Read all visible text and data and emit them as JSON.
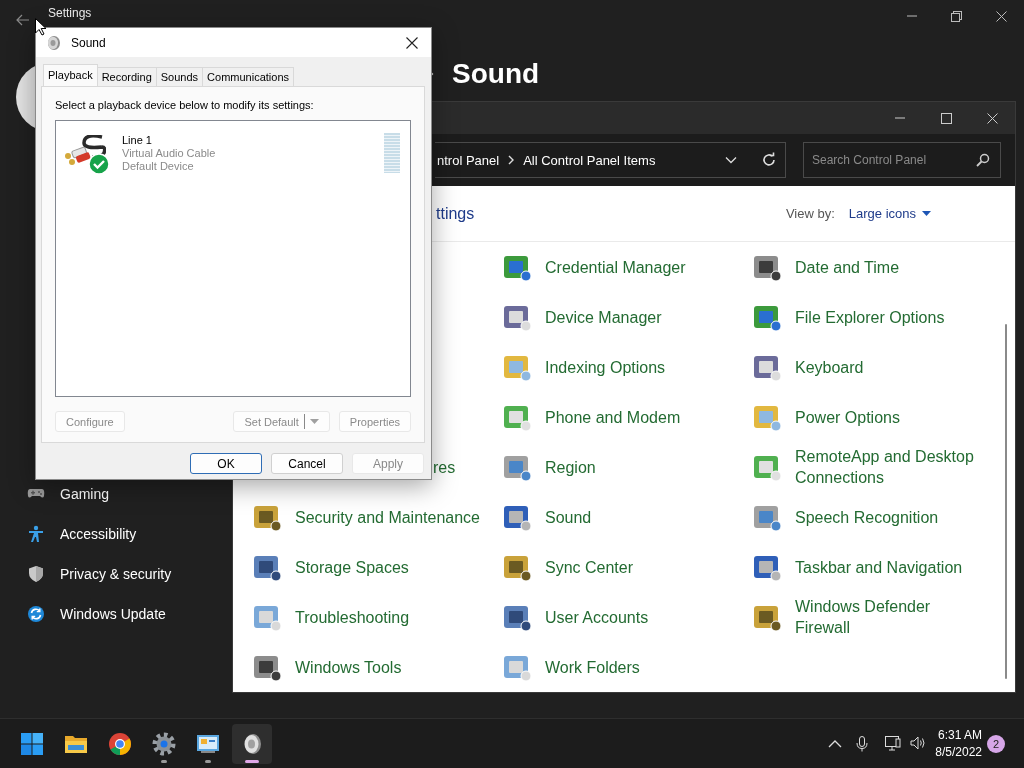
{
  "settings": {
    "title": "Settings",
    "header": "Sound",
    "nav": [
      {
        "label": "Gaming",
        "kind": "gaming"
      },
      {
        "label": "Accessibility",
        "kind": "accessibility"
      },
      {
        "label": "Privacy & security",
        "kind": "privacy"
      },
      {
        "label": "Windows Update",
        "kind": "update"
      }
    ]
  },
  "control_panel": {
    "address": [
      "ntrol Panel",
      "All Control Panel Items"
    ],
    "search": {
      "placeholder": "Search Control Panel"
    },
    "heading": "ttings",
    "view_by": {
      "label": "View by:",
      "value": "Large icons"
    },
    "columns": [
      {
        "items": [
          {
            "label": "res",
            "kind": "clipped"
          },
          {
            "label": "Security and Maintenance",
            "kind": "item"
          },
          {
            "label": "Storage Spaces",
            "kind": "item"
          },
          {
            "label": "Troubleshooting",
            "kind": "item"
          },
          {
            "label": "Windows Tools",
            "kind": "item"
          }
        ]
      },
      {
        "items": [
          {
            "label": "Credential Manager",
            "kind": "item"
          },
          {
            "label": "Device Manager",
            "kind": "item"
          },
          {
            "label": "Indexing Options",
            "kind": "item"
          },
          {
            "label": "Phone and Modem",
            "kind": "item"
          },
          {
            "label": "Region",
            "kind": "item"
          },
          {
            "label": "Sound",
            "kind": "item"
          },
          {
            "label": "Sync Center",
            "kind": "item"
          },
          {
            "label": "User Accounts",
            "kind": "item"
          },
          {
            "label": "Work Folders",
            "kind": "item"
          }
        ]
      },
      {
        "items": [
          {
            "label": "Date and Time",
            "kind": "item"
          },
          {
            "label": "File Explorer Options",
            "kind": "item"
          },
          {
            "label": "Keyboard",
            "kind": "item"
          },
          {
            "label": "Power Options",
            "kind": "item"
          },
          {
            "label": "RemoteApp and Desktop Connections",
            "kind": "item"
          },
          {
            "label": "Speech Recognition",
            "kind": "item"
          },
          {
            "label": "Taskbar and Navigation",
            "kind": "item"
          },
          {
            "label": "Windows Defender Firewall",
            "kind": "item"
          }
        ]
      }
    ]
  },
  "sound_dialog": {
    "title": "Sound",
    "tabs": [
      {
        "label": "Playback",
        "selected": true
      },
      {
        "label": "Recording",
        "selected": false
      },
      {
        "label": "Sounds",
        "selected": false
      },
      {
        "label": "Communications",
        "selected": false
      }
    ],
    "instruction": "Select a playback device below to modify its settings:",
    "devices": [
      {
        "name": "Line 1",
        "description": "Virtual Audio Cable",
        "status": "Default Device",
        "default": true,
        "selected": false,
        "level": 0
      }
    ],
    "device_buttons": [
      {
        "label": "Configure",
        "kind": "plain",
        "disabled": true
      },
      {
        "label": "Set Default",
        "kind": "split",
        "disabled": true
      },
      {
        "label": "Properties",
        "kind": "plain",
        "disabled": true
      }
    ],
    "buttons": [
      {
        "label": "OK",
        "default": true,
        "disabled": false
      },
      {
        "label": "Cancel",
        "default": false,
        "disabled": false
      },
      {
        "label": "Apply",
        "default": false,
        "disabled": true
      }
    ]
  },
  "taskbar": {
    "apps": [
      {
        "kind": "start",
        "running": false,
        "active": false
      },
      {
        "kind": "folder",
        "running": false,
        "active": false
      },
      {
        "kind": "browser",
        "running": false,
        "active": false
      },
      {
        "kind": "settings",
        "running": true,
        "active": false
      },
      {
        "kind": "panel",
        "running": true,
        "active": false
      },
      {
        "kind": "speaker",
        "running": true,
        "active": true
      }
    ],
    "clock": {
      "time": "6:31 AM",
      "date": "8/5/2022"
    },
    "notifications": "2"
  }
}
